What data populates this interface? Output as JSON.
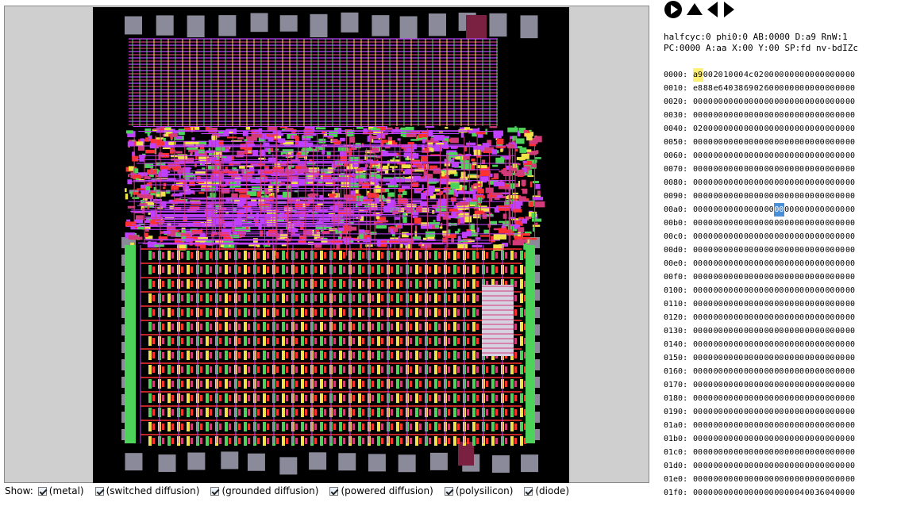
{
  "controls": [
    {
      "name": "play-button",
      "icon": "play-icon"
    },
    {
      "name": "step-up-button",
      "icon": "triangle-up-icon"
    },
    {
      "name": "step-back-button",
      "icon": "triangle-left-icon"
    },
    {
      "name": "step-forward-button",
      "icon": "triangle-right-icon"
    }
  ],
  "status": {
    "line1": "halfcyc:0 phi0:0 AB:0000 D:a9 RnW:1",
    "line2": "PC:0000 A:aa X:00 Y:00 SP:fd nv-bdIZc"
  },
  "memory": {
    "highlight_yellow": {
      "row": 0,
      "col": 0
    },
    "highlight_blue": {
      "row": 10,
      "col": 8
    },
    "rows": [
      {
        "addr": "0000:",
        "bytes": [
          "a9",
          "00",
          "20",
          "10",
          "00",
          "4c",
          "02",
          "00",
          "00",
          "00",
          "00",
          "00",
          "00",
          "00",
          "00",
          "00"
        ]
      },
      {
        "addr": "0010:",
        "bytes": [
          "e8",
          "88",
          "e6",
          "40",
          "38",
          "69",
          "02",
          "60",
          "00",
          "00",
          "00",
          "00",
          "00",
          "00",
          "00",
          "00"
        ]
      },
      {
        "addr": "0020:",
        "bytes": [
          "00",
          "00",
          "00",
          "00",
          "00",
          "00",
          "00",
          "00",
          "00",
          "00",
          "00",
          "00",
          "00",
          "00",
          "00",
          "00"
        ]
      },
      {
        "addr": "0030:",
        "bytes": [
          "00",
          "00",
          "00",
          "00",
          "00",
          "00",
          "00",
          "00",
          "00",
          "00",
          "00",
          "00",
          "00",
          "00",
          "00",
          "00"
        ]
      },
      {
        "addr": "0040:",
        "bytes": [
          "02",
          "00",
          "00",
          "00",
          "00",
          "00",
          "00",
          "00",
          "00",
          "00",
          "00",
          "00",
          "00",
          "00",
          "00",
          "00"
        ]
      },
      {
        "addr": "0050:",
        "bytes": [
          "00",
          "00",
          "00",
          "00",
          "00",
          "00",
          "00",
          "00",
          "00",
          "00",
          "00",
          "00",
          "00",
          "00",
          "00",
          "00"
        ]
      },
      {
        "addr": "0060:",
        "bytes": [
          "00",
          "00",
          "00",
          "00",
          "00",
          "00",
          "00",
          "00",
          "00",
          "00",
          "00",
          "00",
          "00",
          "00",
          "00",
          "00"
        ]
      },
      {
        "addr": "0070:",
        "bytes": [
          "00",
          "00",
          "00",
          "00",
          "00",
          "00",
          "00",
          "00",
          "00",
          "00",
          "00",
          "00",
          "00",
          "00",
          "00",
          "00"
        ]
      },
      {
        "addr": "0080:",
        "bytes": [
          "00",
          "00",
          "00",
          "00",
          "00",
          "00",
          "00",
          "00",
          "00",
          "00",
          "00",
          "00",
          "00",
          "00",
          "00",
          "00"
        ]
      },
      {
        "addr": "0090:",
        "bytes": [
          "00",
          "00",
          "00",
          "00",
          "00",
          "00",
          "00",
          "00",
          "00",
          "00",
          "00",
          "00",
          "00",
          "00",
          "00",
          "00"
        ]
      },
      {
        "addr": "00a0:",
        "bytes": [
          "00",
          "00",
          "00",
          "00",
          "00",
          "00",
          "00",
          "00",
          "00",
          "00",
          "00",
          "00",
          "00",
          "00",
          "00",
          "00"
        ]
      },
      {
        "addr": "00b0:",
        "bytes": [
          "00",
          "00",
          "00",
          "00",
          "00",
          "00",
          "00",
          "00",
          "00",
          "00",
          "00",
          "00",
          "00",
          "00",
          "00",
          "00"
        ]
      },
      {
        "addr": "00c0:",
        "bytes": [
          "00",
          "00",
          "00",
          "00",
          "00",
          "00",
          "00",
          "00",
          "00",
          "00",
          "00",
          "00",
          "00",
          "00",
          "00",
          "00"
        ]
      },
      {
        "addr": "00d0:",
        "bytes": [
          "00",
          "00",
          "00",
          "00",
          "00",
          "00",
          "00",
          "00",
          "00",
          "00",
          "00",
          "00",
          "00",
          "00",
          "00",
          "00"
        ]
      },
      {
        "addr": "00e0:",
        "bytes": [
          "00",
          "00",
          "00",
          "00",
          "00",
          "00",
          "00",
          "00",
          "00",
          "00",
          "00",
          "00",
          "00",
          "00",
          "00",
          "00"
        ]
      },
      {
        "addr": "00f0:",
        "bytes": [
          "00",
          "00",
          "00",
          "00",
          "00",
          "00",
          "00",
          "00",
          "00",
          "00",
          "00",
          "00",
          "00",
          "00",
          "00",
          "00"
        ]
      },
      {
        "addr": "0100:",
        "bytes": [
          "00",
          "00",
          "00",
          "00",
          "00",
          "00",
          "00",
          "00",
          "00",
          "00",
          "00",
          "00",
          "00",
          "00",
          "00",
          "00"
        ]
      },
      {
        "addr": "0110:",
        "bytes": [
          "00",
          "00",
          "00",
          "00",
          "00",
          "00",
          "00",
          "00",
          "00",
          "00",
          "00",
          "00",
          "00",
          "00",
          "00",
          "00"
        ]
      },
      {
        "addr": "0120:",
        "bytes": [
          "00",
          "00",
          "00",
          "00",
          "00",
          "00",
          "00",
          "00",
          "00",
          "00",
          "00",
          "00",
          "00",
          "00",
          "00",
          "00"
        ]
      },
      {
        "addr": "0130:",
        "bytes": [
          "00",
          "00",
          "00",
          "00",
          "00",
          "00",
          "00",
          "00",
          "00",
          "00",
          "00",
          "00",
          "00",
          "00",
          "00",
          "00"
        ]
      },
      {
        "addr": "0140:",
        "bytes": [
          "00",
          "00",
          "00",
          "00",
          "00",
          "00",
          "00",
          "00",
          "00",
          "00",
          "00",
          "00",
          "00",
          "00",
          "00",
          "00"
        ]
      },
      {
        "addr": "0150:",
        "bytes": [
          "00",
          "00",
          "00",
          "00",
          "00",
          "00",
          "00",
          "00",
          "00",
          "00",
          "00",
          "00",
          "00",
          "00",
          "00",
          "00"
        ]
      },
      {
        "addr": "0160:",
        "bytes": [
          "00",
          "00",
          "00",
          "00",
          "00",
          "00",
          "00",
          "00",
          "00",
          "00",
          "00",
          "00",
          "00",
          "00",
          "00",
          "00"
        ]
      },
      {
        "addr": "0170:",
        "bytes": [
          "00",
          "00",
          "00",
          "00",
          "00",
          "00",
          "00",
          "00",
          "00",
          "00",
          "00",
          "00",
          "00",
          "00",
          "00",
          "00"
        ]
      },
      {
        "addr": "0180:",
        "bytes": [
          "00",
          "00",
          "00",
          "00",
          "00",
          "00",
          "00",
          "00",
          "00",
          "00",
          "00",
          "00",
          "00",
          "00",
          "00",
          "00"
        ]
      },
      {
        "addr": "0190:",
        "bytes": [
          "00",
          "00",
          "00",
          "00",
          "00",
          "00",
          "00",
          "00",
          "00",
          "00",
          "00",
          "00",
          "00",
          "00",
          "00",
          "00"
        ]
      },
      {
        "addr": "01a0:",
        "bytes": [
          "00",
          "00",
          "00",
          "00",
          "00",
          "00",
          "00",
          "00",
          "00",
          "00",
          "00",
          "00",
          "00",
          "00",
          "00",
          "00"
        ]
      },
      {
        "addr": "01b0:",
        "bytes": [
          "00",
          "00",
          "00",
          "00",
          "00",
          "00",
          "00",
          "00",
          "00",
          "00",
          "00",
          "00",
          "00",
          "00",
          "00",
          "00"
        ]
      },
      {
        "addr": "01c0:",
        "bytes": [
          "00",
          "00",
          "00",
          "00",
          "00",
          "00",
          "00",
          "00",
          "00",
          "00",
          "00",
          "00",
          "00",
          "00",
          "00",
          "00"
        ]
      },
      {
        "addr": "01d0:",
        "bytes": [
          "00",
          "00",
          "00",
          "00",
          "00",
          "00",
          "00",
          "00",
          "00",
          "00",
          "00",
          "00",
          "00",
          "00",
          "00",
          "00"
        ]
      },
      {
        "addr": "01e0:",
        "bytes": [
          "00",
          "00",
          "00",
          "00",
          "00",
          "00",
          "00",
          "00",
          "00",
          "00",
          "00",
          "00",
          "00",
          "00",
          "00",
          "00"
        ]
      },
      {
        "addr": "01f0:",
        "bytes": [
          "00",
          "00",
          "00",
          "00",
          "00",
          "00",
          "00",
          "00",
          "00",
          "00",
          "04",
          "00",
          "36",
          "04",
          "00",
          "00"
        ]
      }
    ]
  },
  "show": {
    "label": "Show:",
    "options": [
      {
        "name": "metal",
        "label": "(metal)",
        "checked": true
      },
      {
        "name": "switched-diffusion",
        "label": "(switched diffusion)",
        "checked": true
      },
      {
        "name": "grounded-diffusion",
        "label": "(grounded diffusion)",
        "checked": true
      },
      {
        "name": "powered-diffusion",
        "label": "(powered diffusion)",
        "checked": true
      },
      {
        "name": "polysilicon",
        "label": "(polysilicon)",
        "checked": true
      },
      {
        "name": "diode",
        "label": "(diode)",
        "checked": true
      }
    ]
  },
  "colors": {
    "background": "#cfcfcf",
    "chip_background": "#000000",
    "metal": "#d33a7a",
    "switched_diffusion": "#f0e34a",
    "grounded_diffusion": "#4ed35a",
    "powered_diffusion": "#ff3030",
    "polysilicon": "#c040ff",
    "pad": "#8a8a9a",
    "highlight_yellow": "#fff176",
    "highlight_blue": "#4a90d9"
  }
}
